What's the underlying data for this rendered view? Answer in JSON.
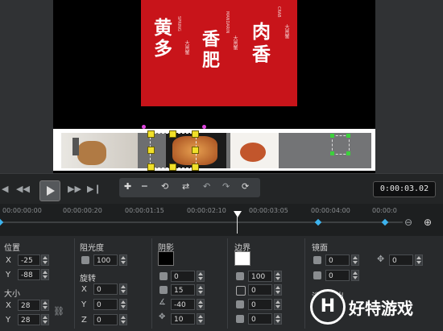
{
  "poster": {
    "title_left": "黄多",
    "title_mid": "香肥",
    "title_right": "肉香",
    "tag_left": "大闸蟹",
    "tag_mid": "大闸蟹",
    "tag_right": "大闸蟹",
    "tiny_left": "SPRING",
    "tiny_mid": "MANDARIN",
    "tiny_right": "CRAB"
  },
  "transport": {
    "timecode": "0:00:03.02"
  },
  "ruler": {
    "ticks": [
      "00:00:00:00",
      "00:00:00:20",
      "00:00:01:15",
      "00:00:02:10",
      "00:00:03:05",
      "00:00:04:00",
      "00:00:0"
    ]
  },
  "properties": {
    "position": {
      "label": "位置",
      "x_label": "X",
      "x": "-25",
      "y_label": "Y",
      "y": "-88"
    },
    "size": {
      "label": "大小",
      "x_label": "X",
      "x": "28",
      "y_label": "Y",
      "y": "28"
    },
    "opacity": {
      "label": "阻光度",
      "value": "100"
    },
    "rotation": {
      "label": "旋转",
      "x_label": "X",
      "x": "0",
      "y_label": "Y",
      "y": "0",
      "z_label": "Z",
      "z": "0"
    },
    "shadow": {
      "label": "阴影",
      "v1": "0",
      "v2": "15",
      "v3": "-40",
      "v4": "10",
      "color": "#000000"
    },
    "border": {
      "label": "边界",
      "v1": "100",
      "v2": "0",
      "v3": "0",
      "v4": "0",
      "color": "#ffffff"
    },
    "mirror": {
      "label": "镜面",
      "v1": "0",
      "v2": "0",
      "v3": "0"
    },
    "fade": {
      "label": "淡入淡出"
    }
  },
  "watermark": {
    "text": "好特游戏",
    "letter": "H"
  }
}
